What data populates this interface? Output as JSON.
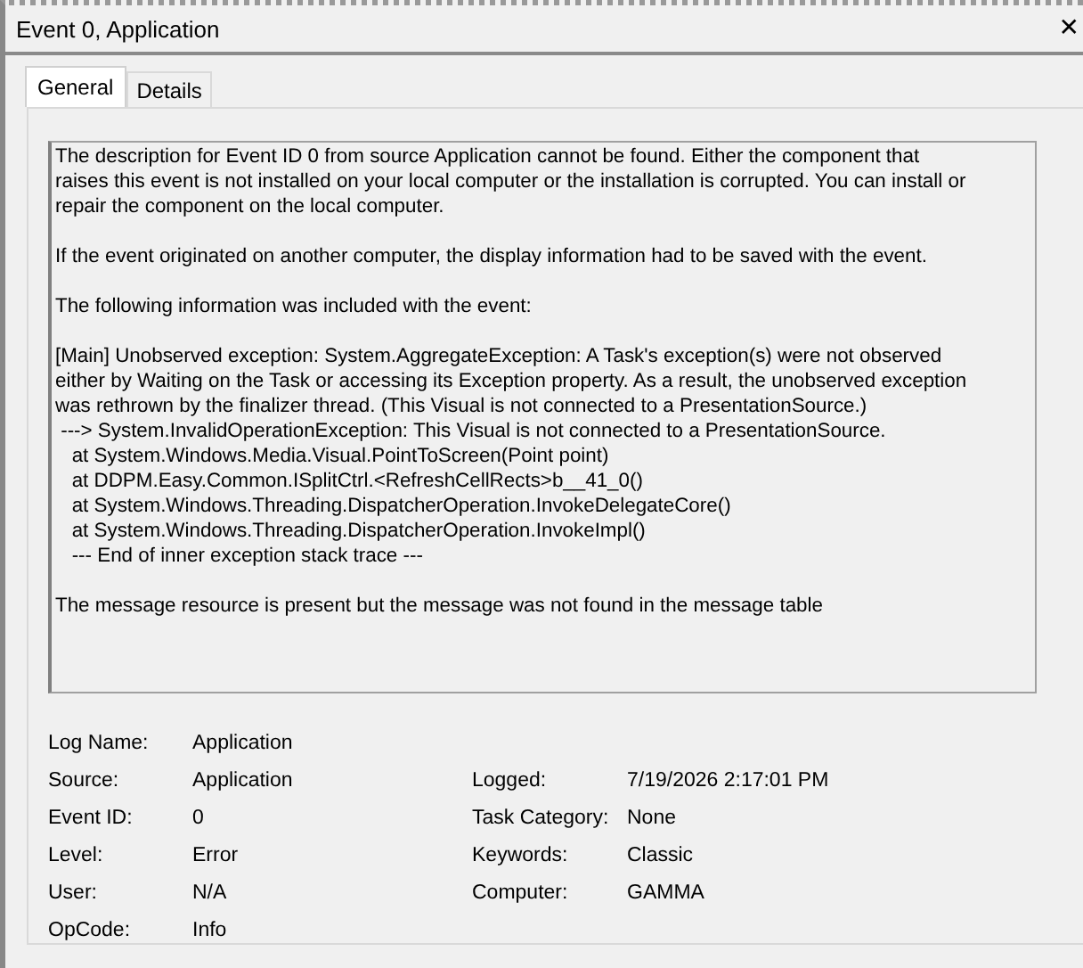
{
  "window": {
    "title": "Event 0, Application",
    "close": "✕"
  },
  "tabs": [
    {
      "label": "General",
      "selected": true
    },
    {
      "label": "Details",
      "selected": false
    }
  ],
  "description": [
    "The description for Event ID 0 from source Application cannot be found. Either the component that\nraises this event is not installed on your local computer or the installation is corrupted. You can install or\nrepair the component on the local computer.",
    "If the event originated on another computer, the display information had to be saved with the event.",
    "The following information was included with the event:",
    "[Main] Unobserved exception: System.AggregateException: A Task's exception(s) were not observed\neither by Waiting on the Task or accessing its Exception property. As a result, the unobserved exception\nwas rethrown by the finalizer thread. (This Visual is not connected to a PresentationSource.)\n ---> System.InvalidOperationException: This Visual is not connected to a PresentationSource.\n   at System.Windows.Media.Visual.PointToScreen(Point point)\n   at DDPM.Easy.Common.ISplitCtrl.<RefreshCellRects>b__41_0()\n   at System.Windows.Threading.DispatcherOperation.InvokeDelegateCore()\n   at System.Windows.Threading.DispatcherOperation.InvokeImpl()\n   --- End of inner exception stack trace ---",
    "The message resource is present but the message was not found in the message table"
  ],
  "fields": [
    {
      "left": {
        "label": "Log Name:",
        "value": "Application"
      }
    },
    {
      "left": {
        "label": "Source:",
        "value": "Application"
      },
      "right": {
        "label": "Logged:",
        "value": "7/19/2026 2:17:01 PM"
      }
    },
    {
      "left": {
        "label": "Event ID:",
        "value": "0"
      },
      "right": {
        "label": "Task Category:",
        "value": "None"
      }
    },
    {
      "left": {
        "label": "Level:",
        "value": "Error"
      },
      "right": {
        "label": "Keywords:",
        "value": "Classic"
      }
    },
    {
      "left": {
        "label": "User:",
        "value": "N/A"
      },
      "right": {
        "label": "Computer:",
        "value": "GAMMA"
      }
    },
    {
      "left": {
        "label": "OpCode:",
        "value": "Info"
      }
    }
  ]
}
